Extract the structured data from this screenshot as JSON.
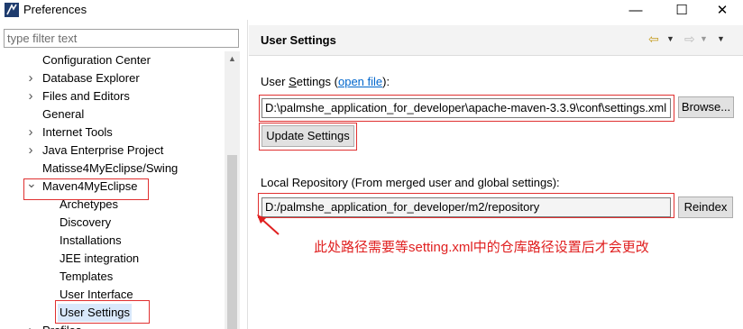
{
  "window": {
    "title": "Preferences",
    "minimize_glyph": "—",
    "maximize_glyph": "☐",
    "close_glyph": "✕"
  },
  "filter": {
    "placeholder": "type filter text",
    "value": ""
  },
  "tree": {
    "items": [
      {
        "label": "Configuration Center",
        "level": 1,
        "expandable": false
      },
      {
        "label": "Database Explorer",
        "level": 1,
        "expandable": true,
        "expanded": false
      },
      {
        "label": "Files and Editors",
        "level": 1,
        "expandable": true,
        "expanded": false
      },
      {
        "label": "General",
        "level": 1,
        "expandable": false
      },
      {
        "label": "Internet Tools",
        "level": 1,
        "expandable": true,
        "expanded": false
      },
      {
        "label": "Java Enterprise Project",
        "level": 1,
        "expandable": true,
        "expanded": false
      },
      {
        "label": "Matisse4MyEclipse/Swing",
        "level": 1,
        "expandable": false
      },
      {
        "label": "Maven4MyEclipse",
        "level": 1,
        "expandable": true,
        "expanded": true
      },
      {
        "label": "Archetypes",
        "level": 2,
        "expandable": false
      },
      {
        "label": "Discovery",
        "level": 2,
        "expandable": false
      },
      {
        "label": "Installations",
        "level": 2,
        "expandable": false
      },
      {
        "label": "JEE integration",
        "level": 2,
        "expandable": false
      },
      {
        "label": "Templates",
        "level": 2,
        "expandable": false
      },
      {
        "label": "User Interface",
        "level": 2,
        "expandable": false
      },
      {
        "label": "User Settings",
        "level": 2,
        "expandable": false,
        "selected": true
      },
      {
        "label": "Profiles",
        "level": 1,
        "expandable": true,
        "expanded": false
      }
    ]
  },
  "page": {
    "title": "User Settings",
    "user_settings_label": "User Settings",
    "user_settings_label_prefix": "User ",
    "user_settings_label_mnemonic": "S",
    "user_settings_label_suffix": "ettings (",
    "open_file_link": "open file",
    "user_settings_label_close": "):",
    "user_settings_path": "D:\\palmshe_application_for_developer\\apache-maven-3.3.9\\conf\\settings.xml",
    "browse_button": "Browse...",
    "update_button": "Update Settings",
    "local_repo_label": "Local Repository (From merged user and global settings):",
    "local_repo_path": "D:/palmshe_application_for_developer/m2/repository",
    "reindex_button": "Reindex"
  },
  "annotation": {
    "note": "此处路径需要等setting.xml中的仓库路径设置后才会更改",
    "color": "#e02020"
  },
  "colors": {
    "selection": "#d9e8fb",
    "highlight_box": "#e03030",
    "link": "#0066cc"
  }
}
